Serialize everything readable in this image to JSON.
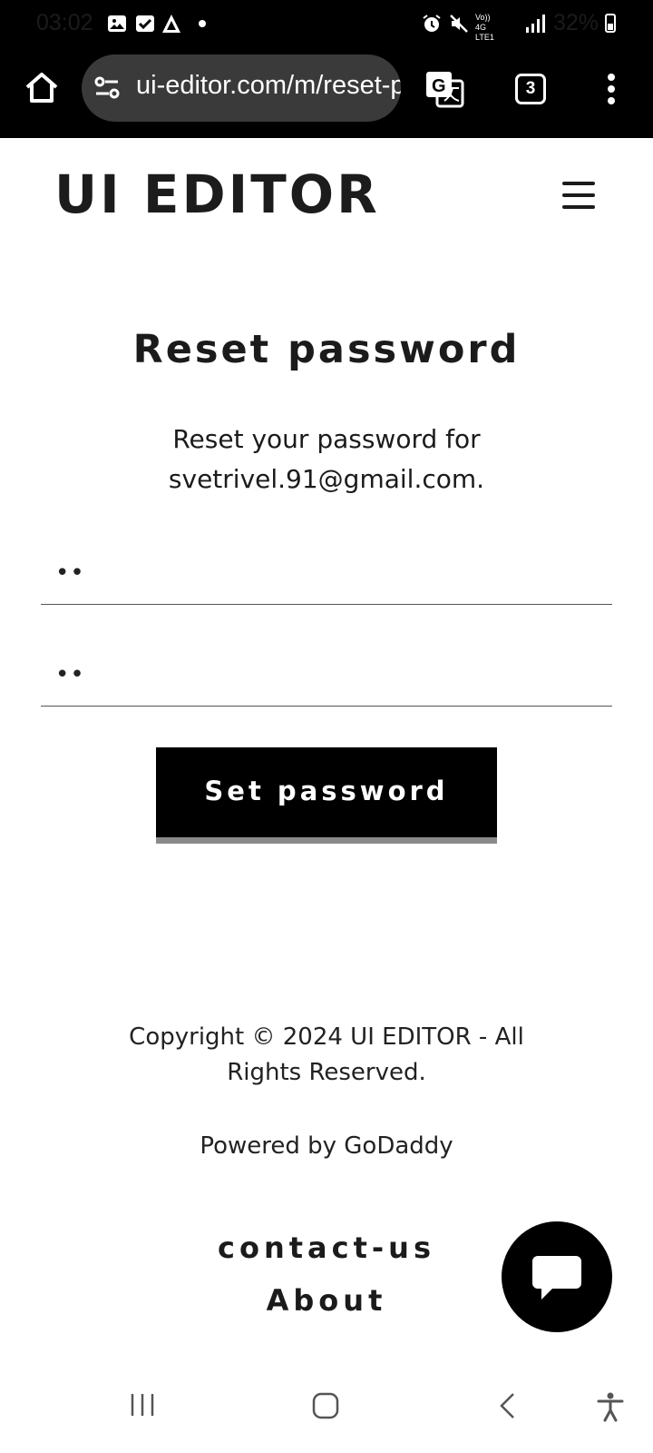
{
  "status_bar": {
    "time": "03:02",
    "battery": "32%",
    "left_icons": [
      "gallery-icon",
      "checkbox-icon",
      "arrow-app-icon",
      "dot-icon"
    ],
    "right_icons": [
      "alarm-icon",
      "mute-icon",
      "volte-icon",
      "4g-icon",
      "signal-icon",
      "battery-icon"
    ],
    "network_top": "Vo)) 4G",
    "network_bottom": "LTE1"
  },
  "browser": {
    "url": "ui-editor.com/m/reset-password",
    "tab_count": "3"
  },
  "site": {
    "logo": "UI EDITOR"
  },
  "main": {
    "title": "Reset password",
    "subtitle": "Reset your password for svetrivel.91@gmail.com.",
    "password_value": "••",
    "confirm_value": "••",
    "submit_label": "Set password"
  },
  "footer": {
    "copyright": "Copyright © 2024 UI EDITOR - All Rights Reserved.",
    "powered": "Powered by GoDaddy",
    "links": [
      "contact-us",
      "About"
    ]
  },
  "colors": {
    "accent": "#000000",
    "text": "#1b1b1b",
    "button_underline": "#8a8a8a"
  }
}
